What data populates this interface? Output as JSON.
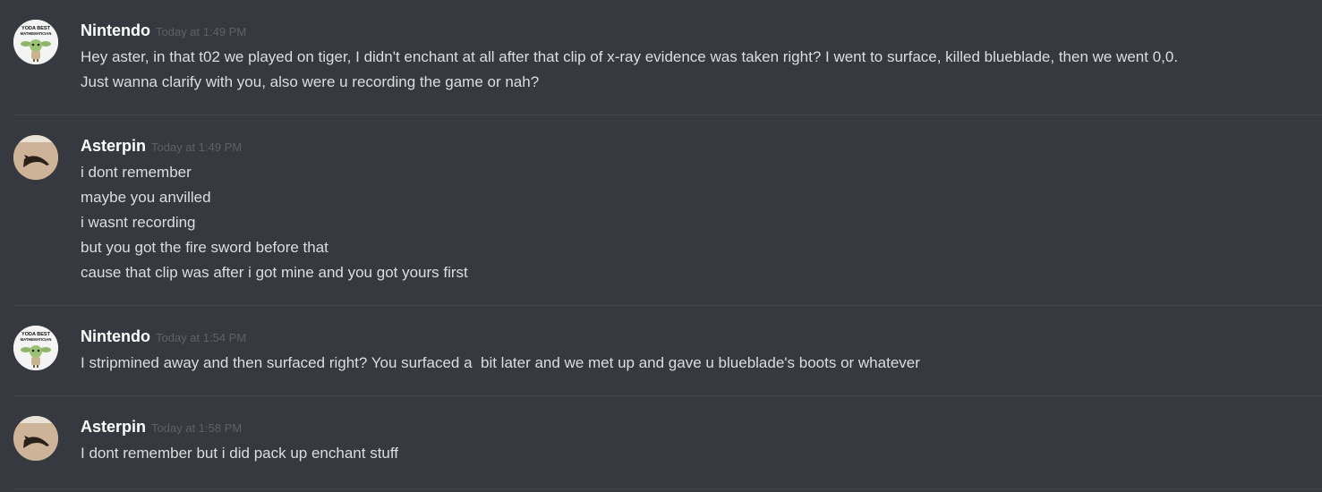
{
  "messages": [
    {
      "author": "Nintendo",
      "timestamp": "Today at 1:49 PM",
      "avatar": "yoda-best-mathematician-avatar",
      "avatar_text": [
        "YODA BEST",
        "MATHEMATICIAN"
      ],
      "lines": [
        "Hey aster, in that t02 we played on tiger, I didn't enchant at all after that clip of x-ray evidence was taken right? I went to surface, killed blueblade, then we went 0,0.",
        "Just wanna clarify with you, also were u recording the game or nah?"
      ]
    },
    {
      "author": "Asterpin",
      "timestamp": "Today at 1:49 PM",
      "avatar": "cat-photo-avatar",
      "lines": [
        "i dont remember",
        "maybe you anvilled",
        "i wasnt recording",
        "but you got the fire sword before that",
        "cause that clip was after i got mine and you got yours first"
      ]
    },
    {
      "author": "Nintendo",
      "timestamp": "Today at 1:54 PM",
      "avatar": "yoda-best-mathematician-avatar",
      "avatar_text": [
        "YODA BEST",
        "MATHEMATICIAN"
      ],
      "lines": [
        "I stripmined away and then surfaced right? You surfaced a  bit later and we met up and gave u blueblade's boots or whatever"
      ]
    },
    {
      "author": "Asterpin",
      "timestamp": "Today at 1:58 PM",
      "avatar": "cat-photo-avatar",
      "lines": [
        "I dont remember but i did pack up enchant stuff"
      ]
    }
  ],
  "colors": {
    "background": "#36393f",
    "username": "#ffffff",
    "timestamp": "#5e6168",
    "message_text": "#dcddde",
    "divider": "#42454a"
  }
}
